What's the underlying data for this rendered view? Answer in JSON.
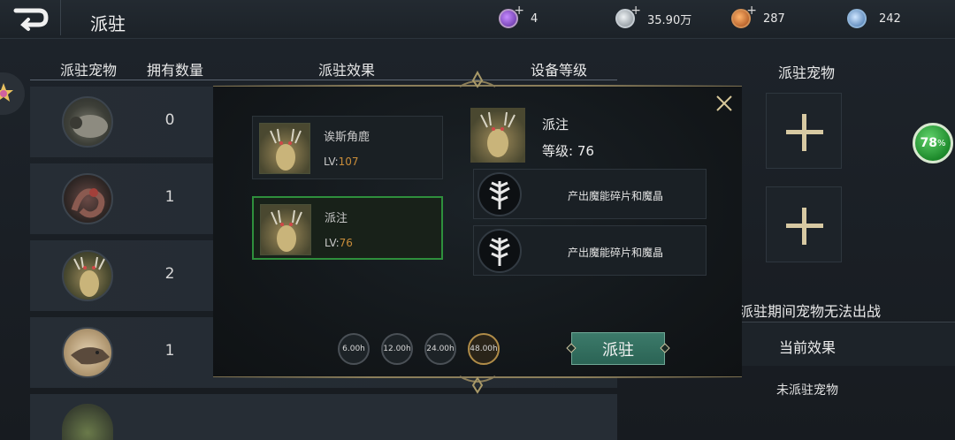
{
  "header": {
    "title": "派驻",
    "currencies": [
      {
        "icon": "purple-gem-icon",
        "value": "4",
        "color": "#8a4ccf"
      },
      {
        "icon": "silver-coin-icon",
        "value": "35.90万",
        "color": "#b9c0c6"
      },
      {
        "icon": "orange-orb-icon",
        "value": "287",
        "color": "#d9833a"
      },
      {
        "icon": "blue-crystal-icon",
        "value": "242",
        "color": "#6ea4d8"
      }
    ]
  },
  "list": {
    "headers": {
      "pet": "派驻宠物",
      "count": "拥有数量",
      "effect": "派驻效果",
      "level": "设备等级"
    },
    "rows": [
      {
        "pet_icon": "sheep-pet-icon",
        "count": "0"
      },
      {
        "pet_icon": "serpent-pet-icon",
        "count": "1"
      },
      {
        "pet_icon": "deer-pet-icon",
        "count": "2"
      },
      {
        "pet_icon": "wolf-pet-icon",
        "count": "1"
      }
    ]
  },
  "right_panel": {
    "title": "派驻宠物",
    "progress": "78",
    "progress_unit": "%",
    "notice": "派驻期间宠物无法出战",
    "current_effect_label": "当前效果",
    "no_pet_text": "未派驻宠物"
  },
  "modal": {
    "pets": [
      {
        "name": "诶斯角鹿",
        "lv_prefix": "LV:",
        "lv": "107",
        "selected": false
      },
      {
        "name": "派注",
        "lv_prefix": "LV:",
        "lv": "76",
        "selected": true
      }
    ],
    "detail": {
      "name": "派注",
      "level_label": "等级:",
      "level": "76",
      "effects": [
        "产出魔能碎片和魔晶",
        "产出魔能碎片和魔晶"
      ]
    },
    "durations": [
      "6.00h",
      "12.00h",
      "24.00h",
      "48.00h"
    ],
    "selected_duration": "48.00h",
    "confirm_label": "派驻"
  },
  "colors": {
    "accent_gold": "#8b7e5a",
    "selected_green": "#2e8f3c",
    "button_teal": "#2b6455",
    "level_orange": "#c98d3a"
  }
}
